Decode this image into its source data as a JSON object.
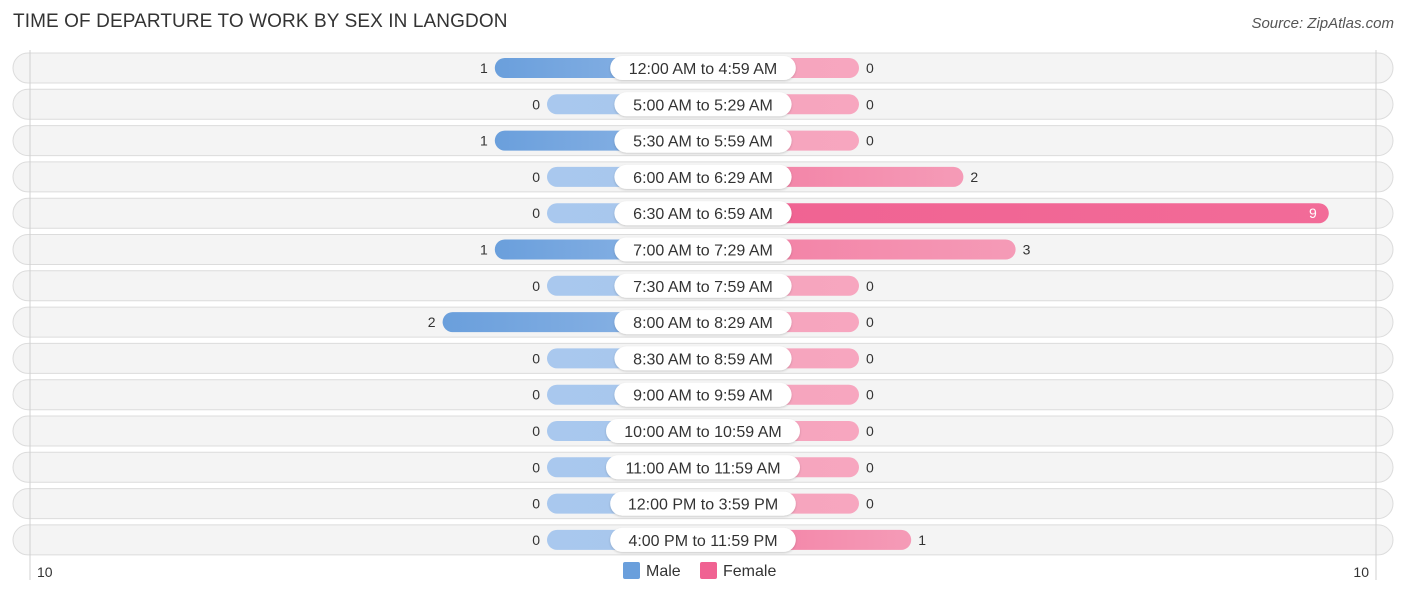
{
  "chart_data": {
    "type": "bar",
    "orientation": "horizontal-diverging",
    "title": "TIME OF DEPARTURE TO WORK BY SEX IN LANGDON",
    "source": "Source: ZipAtlas.com",
    "categories": [
      "12:00 AM to 4:59 AM",
      "5:00 AM to 5:29 AM",
      "5:30 AM to 5:59 AM",
      "6:00 AM to 6:29 AM",
      "6:30 AM to 6:59 AM",
      "7:00 AM to 7:29 AM",
      "7:30 AM to 7:59 AM",
      "8:00 AM to 8:29 AM",
      "8:30 AM to 8:59 AM",
      "9:00 AM to 9:59 AM",
      "10:00 AM to 10:59 AM",
      "11:00 AM to 11:59 AM",
      "12:00 PM to 3:59 PM",
      "4:00 PM to 11:59 PM"
    ],
    "series": [
      {
        "name": "Male",
        "color": "#6a9fdc",
        "values": [
          1,
          0,
          1,
          0,
          0,
          1,
          0,
          2,
          0,
          0,
          0,
          0,
          0,
          0
        ]
      },
      {
        "name": "Female",
        "color": "#f06292",
        "values": [
          0,
          0,
          0,
          2,
          9,
          3,
          0,
          0,
          0,
          0,
          0,
          0,
          0,
          1
        ]
      }
    ],
    "axis": {
      "left_label": "10",
      "right_label": "10",
      "max": 10
    },
    "legend": {
      "position": "bottom-center",
      "items": [
        "Male",
        "Female"
      ]
    },
    "grid": false
  }
}
